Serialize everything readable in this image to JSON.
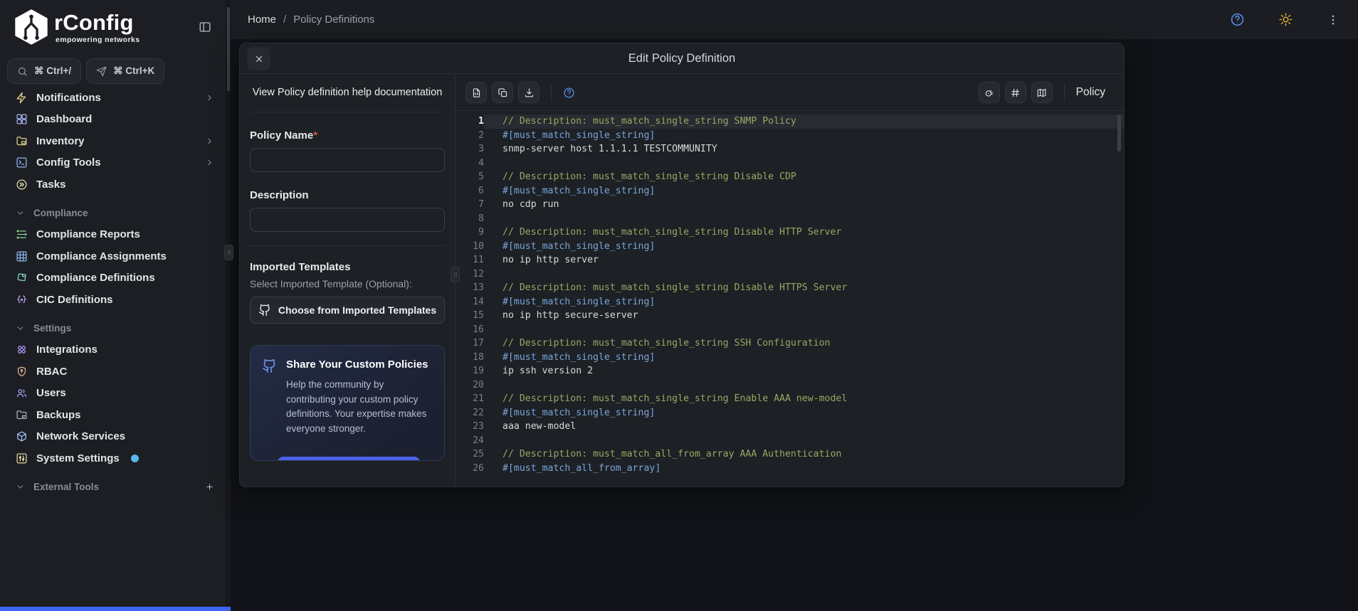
{
  "colors": {
    "accent_blue": "#5b8df0",
    "sun_yellow": "#d7a73e",
    "bottom_bar_blue": "#3e63f2",
    "badge_blue": "#58b7e8",
    "required_red": "#e0524a",
    "card_button_blue": "#4a63e8",
    "card_icon_blue": "#7396ef",
    "syntax_comment": "#93ab64",
    "syntax_directive": "#79a6da",
    "syntax_config": "#d8dad6"
  },
  "sidebar": {
    "logo": {
      "title": "rConfig",
      "tagline": "empowering networks"
    },
    "shortcuts": [
      {
        "icon": "search",
        "label": "⌘ Ctrl+/"
      },
      {
        "icon": "send",
        "label": "⌘ Ctrl+K"
      }
    ],
    "nav": [
      {
        "type": "item",
        "label": "Notifications",
        "icon": "bolt",
        "color": "#e7d492",
        "chevron": true
      },
      {
        "type": "item",
        "label": "Dashboard",
        "icon": "grid",
        "color": "#aab3f2"
      },
      {
        "type": "item",
        "label": "Inventory",
        "icon": "folder-box",
        "color": "#d9cf8d",
        "chevron": true
      },
      {
        "type": "item",
        "label": "Config Tools",
        "icon": "terminal",
        "color": "#8fb5f2",
        "chevron": true
      },
      {
        "type": "item",
        "label": "Tasks",
        "icon": "chevrons-circle",
        "color": "#e0d9a8"
      },
      {
        "type": "section",
        "label": "Compliance"
      },
      {
        "type": "item",
        "label": "Compliance Reports",
        "icon": "report-list",
        "color": "#8fd694"
      },
      {
        "type": "item",
        "label": "Compliance Assignments",
        "icon": "table",
        "color": "#8ab6ea"
      },
      {
        "type": "item",
        "label": "Compliance Definitions",
        "icon": "sticker",
        "color": "#82d8d8"
      },
      {
        "type": "item",
        "label": "CIC Definitions",
        "icon": "braces-x",
        "color": "#b9a1f0"
      },
      {
        "type": "section",
        "label": "Settings"
      },
      {
        "type": "item",
        "label": "Integrations",
        "icon": "cross-x",
        "color": "#a993f0"
      },
      {
        "type": "item",
        "label": "RBAC",
        "icon": "shield-pin",
        "color": "#ddb48c"
      },
      {
        "type": "item",
        "label": "Users",
        "icon": "users",
        "color": "#a9a5f2"
      },
      {
        "type": "item",
        "label": "Backups",
        "icon": "folder-drive",
        "color": "#a9b2bd"
      },
      {
        "type": "item",
        "label": "Network Services",
        "icon": "cube",
        "color": "#9fc9f5"
      },
      {
        "type": "item",
        "label": "System Settings",
        "icon": "sliders",
        "color": "#ded5a2",
        "badge": true
      },
      {
        "type": "section",
        "label": "External Tools",
        "plus": true
      }
    ]
  },
  "topbar": {
    "breadcrumb": [
      "Home",
      "Policy Definitions"
    ],
    "breadcrumb_sep": "/"
  },
  "modal": {
    "title": "Edit Policy Definition",
    "form": {
      "help_link": "View Policy definition help documentation",
      "policy_name_label": "Policy Name",
      "required_marker": "*",
      "description_label": "Description",
      "imported_templates_title": "Imported Templates",
      "imported_templates_hint": "Select Imported Template (Optional):",
      "choose_button": "Choose from Imported Templates",
      "share_card": {
        "title": "Share Your Custom Policies",
        "body": "Help the community by contributing your custom policy definitions. Your expertise makes everyone stronger."
      }
    },
    "editor": {
      "mode_label": "Policy",
      "lines": [
        {
          "type": "comment",
          "text": "// Description: must_match_single_string SNMP Policy",
          "active": true
        },
        {
          "type": "directive",
          "text": "#[must_match_single_string]"
        },
        {
          "type": "config",
          "text": "snmp-server host 1.1.1.1 TESTCOMMUNITY"
        },
        {
          "type": "blank",
          "text": ""
        },
        {
          "type": "comment",
          "text": "// Description: must_match_single_string Disable CDP"
        },
        {
          "type": "directive",
          "text": "#[must_match_single_string]"
        },
        {
          "type": "config",
          "text": "no cdp run"
        },
        {
          "type": "blank",
          "text": ""
        },
        {
          "type": "comment",
          "text": "// Description: must_match_single_string Disable HTTP Server"
        },
        {
          "type": "directive",
          "text": "#[must_match_single_string]"
        },
        {
          "type": "config",
          "text": "no ip http server"
        },
        {
          "type": "blank",
          "text": ""
        },
        {
          "type": "comment",
          "text": "// Description: must_match_single_string Disable HTTPS Server"
        },
        {
          "type": "directive",
          "text": "#[must_match_single_string]"
        },
        {
          "type": "config",
          "text": "no ip http secure-server"
        },
        {
          "type": "blank",
          "text": ""
        },
        {
          "type": "comment",
          "text": "// Description: must_match_single_string SSH Configuration"
        },
        {
          "type": "directive",
          "text": "#[must_match_single_string]"
        },
        {
          "type": "config",
          "text": "ip ssh version 2"
        },
        {
          "type": "blank",
          "text": ""
        },
        {
          "type": "comment",
          "text": "// Description: must_match_single_string Enable AAA new-model"
        },
        {
          "type": "directive",
          "text": "#[must_match_single_string]"
        },
        {
          "type": "config",
          "text": "aaa new-model"
        },
        {
          "type": "blank",
          "text": ""
        },
        {
          "type": "comment",
          "text": "// Description: must_match_all_from_array AAA Authentication"
        },
        {
          "type": "directive",
          "text": "#[must_match_all_from_array]"
        }
      ]
    }
  }
}
